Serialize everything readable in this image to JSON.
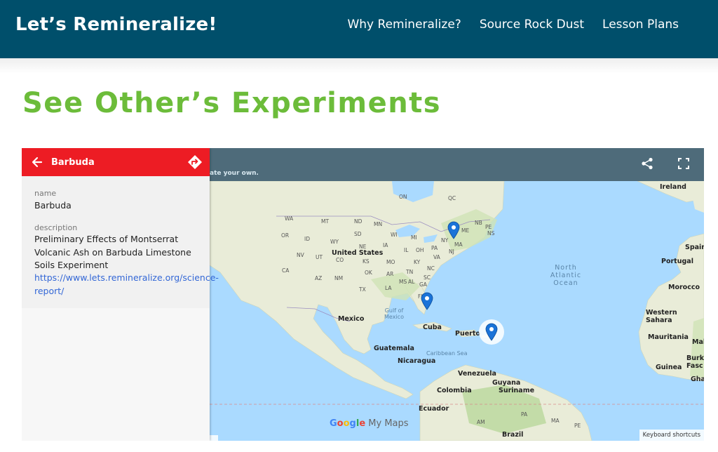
{
  "site": {
    "brand": "Let’s Remineralize!",
    "nav": [
      "Why Remineralize?",
      "Source Rock Dust",
      "Lesson Plans"
    ]
  },
  "page": {
    "title": "See Other’s Experiments"
  },
  "map_embed": {
    "header_snippet": "ate your own.",
    "panel": {
      "title": "Barbuda",
      "name_label": "name",
      "name_value": "Barbuda",
      "description_label": "description",
      "description_value": "Preliminary Effects of Montserrat Volcanic Ash on Barbuda Limestone Soils Experiment",
      "link": "https://www.lets.remineralize.org/science-report/"
    },
    "labels": {
      "ireland": "Ireland",
      "on": "ON",
      "qc": "QC",
      "nb": "NB",
      "pe": "PE",
      "me": "ME",
      "ns": "NS",
      "wa": "WA",
      "mt": "MT",
      "nd": "ND",
      "mn": "MN",
      "or": "OR",
      "id": "ID",
      "sd": "SD",
      "wi": "WI",
      "mi": "MI",
      "wy": "WY",
      "ia": "IA",
      "ny": "NY",
      "ma": "MA",
      "nv": "NV",
      "ut": "UT",
      "ne": "NE",
      "il": "IL",
      "oh": "OH",
      "pa": "PA",
      "ca": "CA",
      "co": "CO",
      "ks": "KS",
      "mo": "MO",
      "ky": "KY",
      "va": "VA",
      "nj": "NJ",
      "az": "AZ",
      "nm": "NM",
      "ok": "OK",
      "ar": "AR",
      "tn": "TN",
      "nc": "NC",
      "sc": "SC",
      "tx": "TX",
      "la": "LA",
      "ms": "MS",
      "al": "AL",
      "ga": "GA",
      "fl": "FL",
      "united_states": "United States",
      "north_atlantic_ocean": "North Atlantic Ocean",
      "spain": "Spain",
      "portugal": "Portugal",
      "morocco": "Morocco",
      "western_sahara": "Western Sahara",
      "mauritania": "Mauritania",
      "mali": "Mali",
      "burkina_faso": "Burki Fasc",
      "guinea": "Guinea",
      "ghana": "Gha",
      "gulf_of_mexico": "Gulf of Mexico",
      "mexico": "Mexico",
      "cuba": "Cuba",
      "puerto_rico": "Puerto",
      "guatemala": "Guatemala",
      "nicaragua": "Nicaragua",
      "caribbean_sea": "Caribbean Sea",
      "venezuela": "Venezuela",
      "guyana": "Guyana",
      "suriname": "Suriname",
      "colombia": "Colombia",
      "ecuador": "Ecuador",
      "brazil": "Brazil",
      "am": "AM",
      "pa_br": "PA",
      "ma_br": "MA",
      "pe_br": "PE"
    },
    "google_logo": {
      "g": "G",
      "o1": "o",
      "o2": "o",
      "g2": "g",
      "l": "l",
      "e": "e",
      "suffix": "My Maps"
    },
    "keyboard_shortcuts": "Keyboard shortcuts",
    "pins": [
      "massachusetts-pin",
      "florida-pin",
      "barbuda-pin"
    ],
    "colors": {
      "header": "#004f6b",
      "title": "#6cbc3a",
      "panel_header": "#ed1c24",
      "pin": "#1a73d8",
      "water": "#aadaff",
      "land": "#e8ecd7"
    }
  }
}
